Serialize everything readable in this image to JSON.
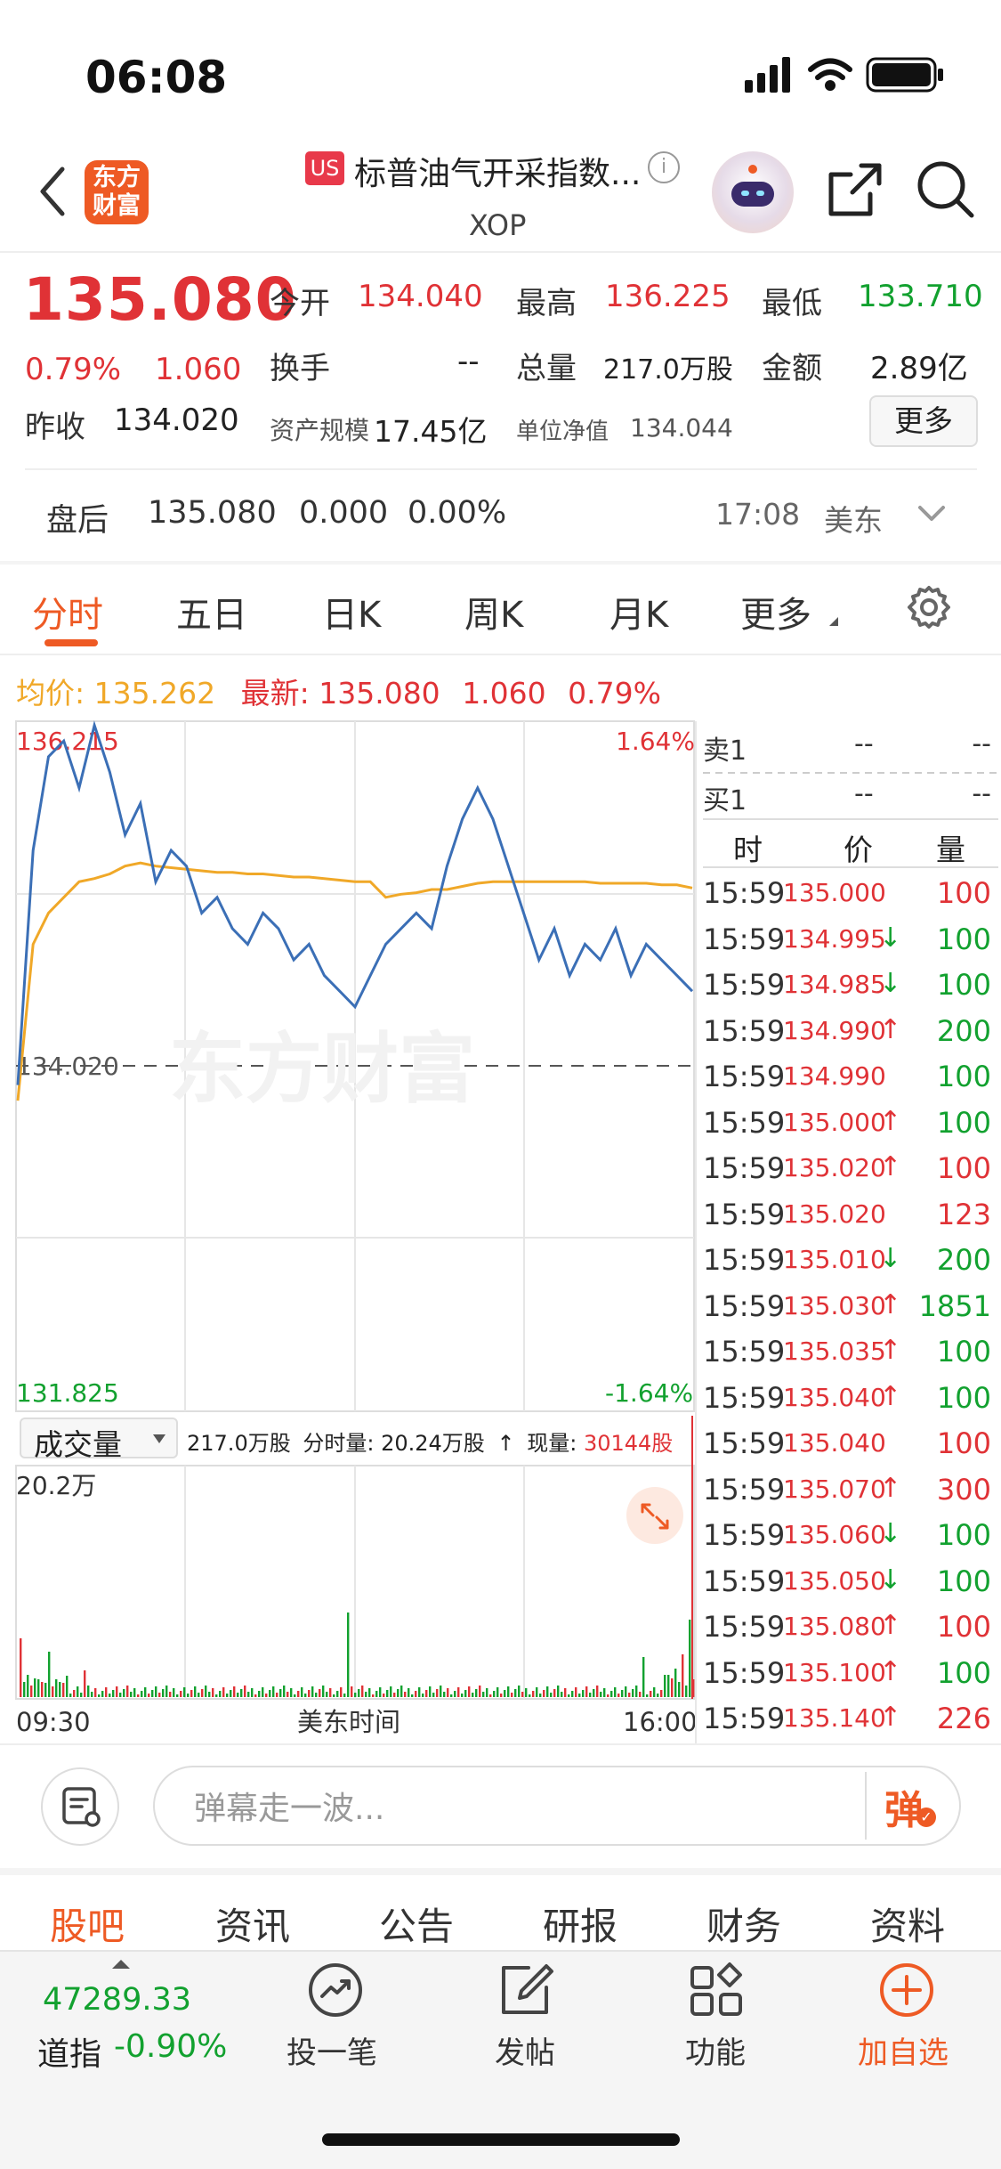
{
  "status_bar": {
    "time": "06:08"
  },
  "header": {
    "logo_text_1": "东方",
    "logo_text_2": "财富",
    "market_badge": "US",
    "title": "标普油气开采指数...",
    "code": "XOP",
    "info_icon": "ⓘ"
  },
  "quote": {
    "price": "135.080",
    "change_pct": "0.79%",
    "change": "1.060",
    "prev_close_label": "昨收",
    "prev_close": "134.020",
    "open_label": "今开",
    "open": "134.040",
    "high_label": "最高",
    "high": "136.225",
    "low_label": "最低",
    "low": "133.710",
    "turnover_label": "换手",
    "turnover": "--",
    "volume_label": "总量",
    "volume": "217.0万股",
    "amount_label": "金额",
    "amount": "2.89亿",
    "aum_label": "资产规模",
    "aum": "17.45亿",
    "nav_label": "单位净值",
    "nav": "134.044",
    "more_button": "更多"
  },
  "after_hours": {
    "label": "盘后",
    "price": "135.080",
    "change": "0.000",
    "change_pct": "0.00%",
    "time": "17:08",
    "zone": "美东"
  },
  "tabs": [
    "分时",
    "五日",
    "日K",
    "周K",
    "月K",
    "更多"
  ],
  "avg_row": {
    "avg_label": "均价:",
    "avg_value": "135.262",
    "latest_label": "最新:",
    "latest_value": "135.080",
    "latest_change": "1.060",
    "latest_pct": "0.79%"
  },
  "chart": {
    "high_label": "136.215",
    "high_pct": "1.64%",
    "prev_close_label": "134.020",
    "low_label": "131.825",
    "low_pct": "-1.64%",
    "watermark": "东方财富",
    "volume_selector": "成交量",
    "volume_info_total": "217.0万股",
    "volume_info_period_label": "分时量:",
    "volume_info_period": "20.24万股",
    "volume_info_now_label": "现量:",
    "volume_info_now": "30144股",
    "volume_max_label": "20.2万",
    "time_start": "09:30",
    "time_mid": "美东时间",
    "time_end": "16:00"
  },
  "chart_data": {
    "type": "line",
    "title": "",
    "xlabel": "美东时间",
    "ylabel": "",
    "x_range": [
      "09:30",
      "16:00"
    ],
    "ylim": [
      131.825,
      136.215
    ],
    "prev_close": 134.02,
    "series": [
      {
        "name": "最新",
        "color": "#3b6fb6",
        "values": [
          133.9,
          135.4,
          136.0,
          136.1,
          135.8,
          136.2,
          135.9,
          135.5,
          135.7,
          135.2,
          135.4,
          135.3,
          135.0,
          135.1,
          134.9,
          134.8,
          135.0,
          134.9,
          134.7,
          134.8,
          134.6,
          134.5,
          134.4,
          134.6,
          134.8,
          134.9,
          135.0,
          134.9,
          135.3,
          135.6,
          135.8,
          135.6,
          135.3,
          135.0,
          134.7,
          134.9,
          134.6,
          134.8,
          134.7,
          134.9,
          134.6,
          134.8,
          134.7,
          134.6,
          134.5
        ]
      },
      {
        "name": "均价",
        "color": "#f0a828",
        "values": [
          133.8,
          134.8,
          135.0,
          135.1,
          135.2,
          135.22,
          135.25,
          135.3,
          135.32,
          135.3,
          135.29,
          135.28,
          135.27,
          135.26,
          135.26,
          135.25,
          135.25,
          135.24,
          135.23,
          135.23,
          135.22,
          135.21,
          135.2,
          135.2,
          135.1,
          135.12,
          135.13,
          135.15,
          135.15,
          135.17,
          135.19,
          135.2,
          135.2,
          135.2,
          135.2,
          135.2,
          135.2,
          135.2,
          135.19,
          135.19,
          135.19,
          135.19,
          135.18,
          135.18,
          135.16
        ]
      }
    ]
  },
  "order_book": {
    "sell1_label": "卖1",
    "sell1_price": "--",
    "sell1_vol": "--",
    "buy1_label": "买1",
    "buy1_price": "--",
    "buy1_vol": "--",
    "head_time": "时",
    "head_price": "价",
    "head_vol": "量",
    "ticks": [
      {
        "time": "15:59",
        "price": "135.000",
        "arrow": "",
        "vol": "100",
        "vol_color": "red"
      },
      {
        "time": "15:59",
        "price": "134.995",
        "arrow": "↓",
        "vol": "100",
        "vol_color": "green"
      },
      {
        "time": "15:59",
        "price": "134.985",
        "arrow": "↓",
        "vol": "100",
        "vol_color": "green"
      },
      {
        "time": "15:59",
        "price": "134.990",
        "arrow": "↑",
        "vol": "200",
        "vol_color": "green"
      },
      {
        "time": "15:59",
        "price": "134.990",
        "arrow": "",
        "vol": "100",
        "vol_color": "green"
      },
      {
        "time": "15:59",
        "price": "135.000",
        "arrow": "↑",
        "vol": "100",
        "vol_color": "green"
      },
      {
        "time": "15:59",
        "price": "135.020",
        "arrow": "↑",
        "vol": "100",
        "vol_color": "red"
      },
      {
        "time": "15:59",
        "price": "135.020",
        "arrow": "",
        "vol": "123",
        "vol_color": "red"
      },
      {
        "time": "15:59",
        "price": "135.010",
        "arrow": "↓",
        "vol": "200",
        "vol_color": "green"
      },
      {
        "time": "15:59",
        "price": "135.030",
        "arrow": "↑",
        "vol": "1851",
        "vol_color": "green"
      },
      {
        "time": "15:59",
        "price": "135.035",
        "arrow": "↑",
        "vol": "100",
        "vol_color": "green"
      },
      {
        "time": "15:59",
        "price": "135.040",
        "arrow": "↑",
        "vol": "100",
        "vol_color": "green"
      },
      {
        "time": "15:59",
        "price": "135.040",
        "arrow": "",
        "vol": "100",
        "vol_color": "red"
      },
      {
        "time": "15:59",
        "price": "135.070",
        "arrow": "↑",
        "vol": "300",
        "vol_color": "red"
      },
      {
        "time": "15:59",
        "price": "135.060",
        "arrow": "↓",
        "vol": "100",
        "vol_color": "green"
      },
      {
        "time": "15:59",
        "price": "135.050",
        "arrow": "↓",
        "vol": "100",
        "vol_color": "green"
      },
      {
        "time": "15:59",
        "price": "135.080",
        "arrow": "↑",
        "vol": "100",
        "vol_color": "red"
      },
      {
        "time": "15:59",
        "price": "135.100",
        "arrow": "↑",
        "vol": "100",
        "vol_color": "green"
      },
      {
        "time": "15:59",
        "price": "135.140",
        "arrow": "↑",
        "vol": "226",
        "vol_color": "red"
      }
    ]
  },
  "danmu": {
    "placeholder": "弹幕走一波...",
    "send": "弹"
  },
  "bottom_tabs": [
    "股吧",
    "资讯",
    "公告",
    "研报",
    "财务",
    "资料"
  ],
  "bottom_bar": {
    "index_value": "47289.33",
    "index_name": "道指",
    "index_change": "-0.90%",
    "invest_label": "投一笔",
    "post_label": "发帖",
    "function_label": "功能",
    "add_watch_label": "加自选"
  },
  "colors": {
    "red": "#e03236",
    "green": "#12a12f",
    "accent": "#ee5a24",
    "price_line": "#3b6fb6",
    "avg_line": "#f0a828"
  }
}
